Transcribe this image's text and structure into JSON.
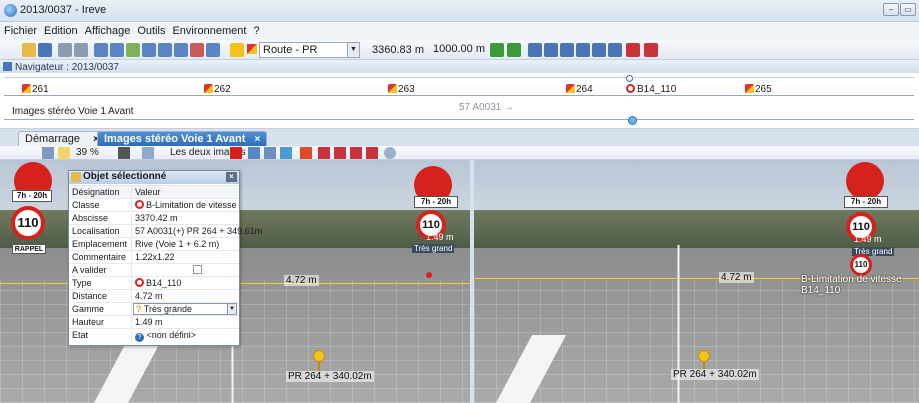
{
  "window": {
    "title": "2013/0037 - Ireve"
  },
  "menu": [
    "Fichier",
    "Edition",
    "Affichage",
    "Outils",
    "Environnement",
    "?"
  ],
  "toolbar": {
    "route_select": "Route - PR",
    "position": "3360.83 m",
    "distance": "1000.00 m"
  },
  "navigator": {
    "title": "Navigateur : 2013/0037",
    "points": [
      "261",
      "262",
      "263",
      "264",
      "B14_110",
      "265"
    ],
    "track_label": "Images stéréo Voie 1 Avant",
    "road_label": "57 A0031 →"
  },
  "tabs": [
    {
      "label": "Démarrage"
    },
    {
      "label": "Images stéréo Voie 1 Avant"
    }
  ],
  "view_toolbar": {
    "zoom": "39 %",
    "images_select": "Les deux images"
  },
  "props": {
    "title": "Objet sélectionné",
    "header_key": "Désignation",
    "header_val": "Valeur",
    "rows": [
      {
        "key": "Classe",
        "val": "B-Limitation de vitesse"
      },
      {
        "key": "Abscisse",
        "val": "3370.42 m"
      },
      {
        "key": "Localisation",
        "val": "57 A0031(+) PR 264 + 349.61m"
      },
      {
        "key": "Emplacement",
        "val": "Rive (Voie 1 + 6.2 m)"
      },
      {
        "key": "Commentaire",
        "val": "1.22x1.22"
      },
      {
        "key": "A valider",
        "val": ""
      },
      {
        "key": "Type",
        "val": "B14_110"
      },
      {
        "key": "Distance",
        "val": "4.72 m"
      },
      {
        "key": "Gamme",
        "val": "Très grande"
      },
      {
        "key": "Hauteur",
        "val": "1.49 m"
      },
      {
        "key": "Etat",
        "val": "<non défini>"
      }
    ]
  },
  "left_image": {
    "sign_time": "7h - 20h",
    "speed": "110",
    "rappel": "RAPPEL",
    "sign_time_right": "7h - 20h",
    "speed_right": "110",
    "height_label": "1.49 m",
    "gamme_label": "Très grand",
    "distance_label": "4.72 m",
    "pr_label": "PR 264 + 340.02m"
  },
  "right_image": {
    "sign_time": "7h - 20h",
    "speed": "110",
    "height_label": "1.49 m",
    "gamme_label": "Très grand",
    "distance_label": "4.72 m",
    "class_label": "B-Limitation de vitesse B14_110",
    "pr_label": "PR 264 + 340.02m"
  },
  "colors": {
    "accent": "#2a6fb8",
    "sign_red": "#d5231b",
    "marker_yellow": "#f3c21b"
  }
}
